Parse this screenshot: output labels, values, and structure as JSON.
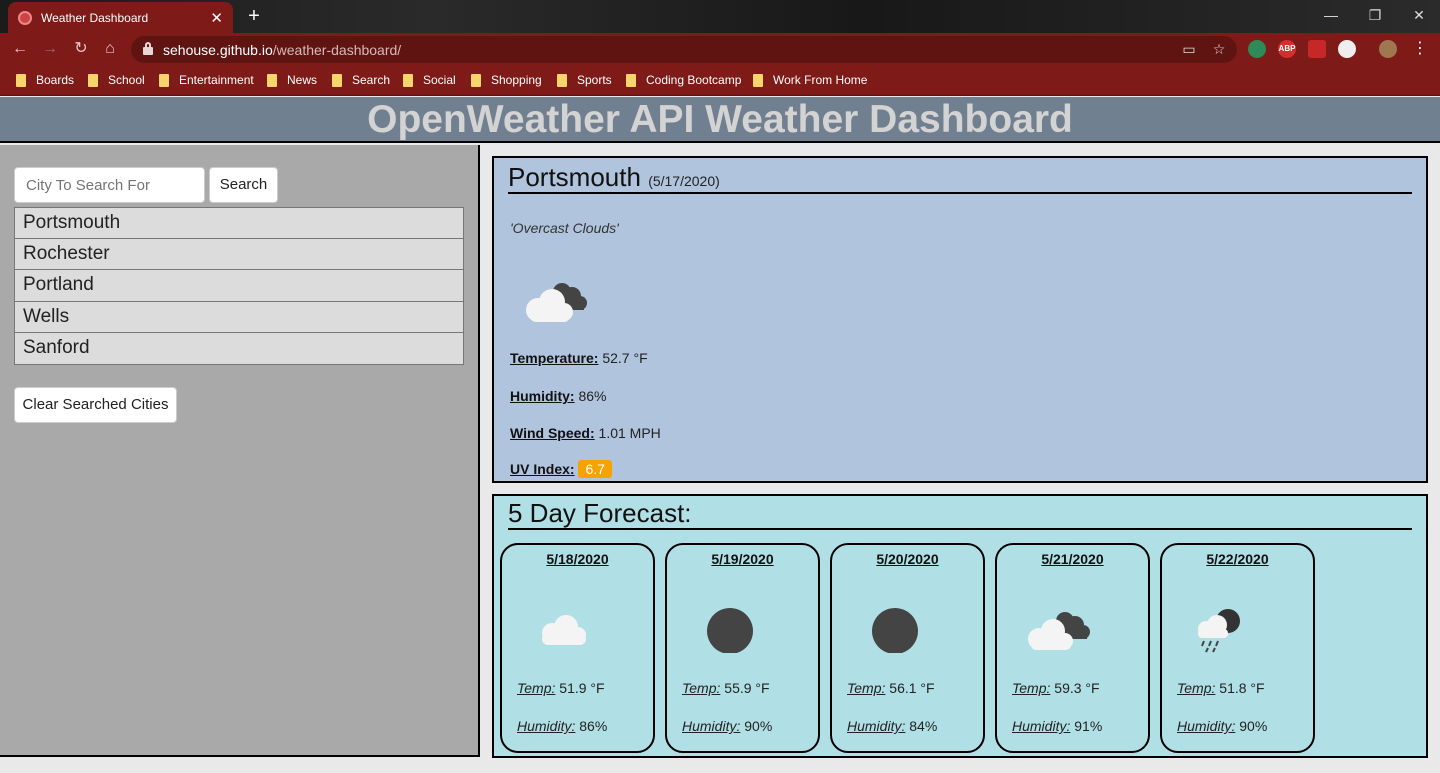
{
  "browser": {
    "tab_title": "Weather Dashboard",
    "url_host": "sehouse.github.io",
    "url_path": "/weather-dashboard/",
    "bookmarks": [
      "Boards",
      "School",
      "Entertainment",
      "News",
      "Search",
      "Social",
      "Shopping",
      "Sports",
      "Coding Bootcamp",
      "Work From Home"
    ],
    "extensions": [
      {
        "icon": "palette-extension-icon",
        "text": "",
        "color": "#2e8b57"
      },
      {
        "icon": "adblock-plus-icon",
        "text": "ABP",
        "color": "#d32f2f"
      },
      {
        "icon": "video-extension-icon",
        "text": "",
        "color": "#c62828"
      },
      {
        "icon": "clock-extension-icon",
        "text": "",
        "color": "#eeeeee"
      }
    ]
  },
  "page": {
    "title": "OpenWeather API Weather Dashboard",
    "search": {
      "placeholder": "City To Search For",
      "button_label": "Search"
    },
    "cities": [
      "Portsmouth",
      "Rochester",
      "Portland",
      "Wells",
      "Sanford"
    ],
    "clear_label": "Clear Searched Cities"
  },
  "current": {
    "city": "Portsmouth",
    "date": "(5/17/2020)",
    "description": "'Overcast Clouds'",
    "icon": "overcast-clouds-icon",
    "temperature_label": "Temperature:",
    "temperature": "52.7 °F",
    "humidity_label": "Humidity:",
    "humidity": "86%",
    "wind_label": "Wind Speed:",
    "wind": "1.01 MPH",
    "uv_label": "UV Index:",
    "uv": "6.7",
    "uv_color": "#f4a300"
  },
  "forecast": {
    "title": "5 Day Forecast:",
    "temp_label": "Temp:",
    "humidity_label": "Humidity:",
    "days": [
      {
        "date": "5/18/2020",
        "icon": "cloud-icon",
        "temp": "51.9 °F",
        "humidity": "86%"
      },
      {
        "date": "5/19/2020",
        "icon": "dark-circle-icon",
        "temp": "55.9 °F",
        "humidity": "90%"
      },
      {
        "date": "5/20/2020",
        "icon": "dark-circle-icon",
        "temp": "56.1 °F",
        "humidity": "84%"
      },
      {
        "date": "5/21/2020",
        "icon": "overcast-clouds-icon",
        "temp": "59.3 °F",
        "humidity": "91%"
      },
      {
        "date": "5/22/2020",
        "icon": "rain-cloud-icon",
        "temp": "51.8 °F",
        "humidity": "90%"
      }
    ]
  }
}
